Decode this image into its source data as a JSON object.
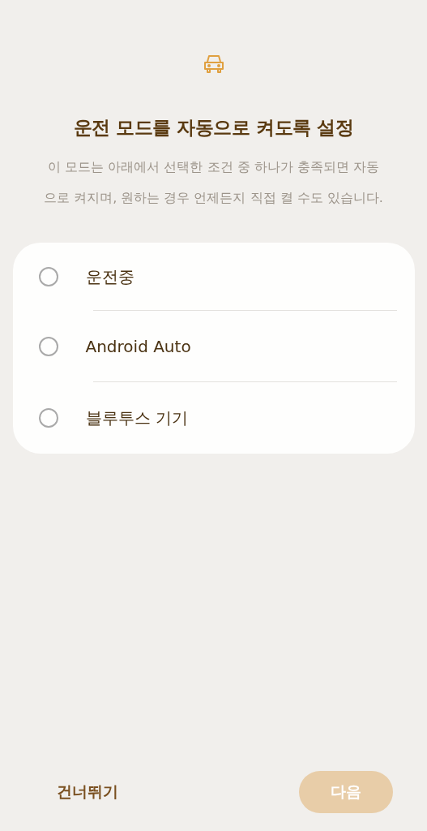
{
  "header": {
    "title": "운전 모드를 자동으로 켜도록 설정",
    "description": "이 모드는 아래에서 선택한 조건 중 하나가 충족되면 자동으로 켜지며, 원하는 경우 언제든지 직접 켤 수도 있습니다."
  },
  "options": [
    {
      "label": "운전중",
      "selected": false
    },
    {
      "label": "Android Auto",
      "selected": false
    },
    {
      "label": "블루투스 기기",
      "selected": false
    }
  ],
  "footer": {
    "skip": "건너뛰기",
    "next": {
      "label": "다음",
      "disabled": true
    }
  }
}
